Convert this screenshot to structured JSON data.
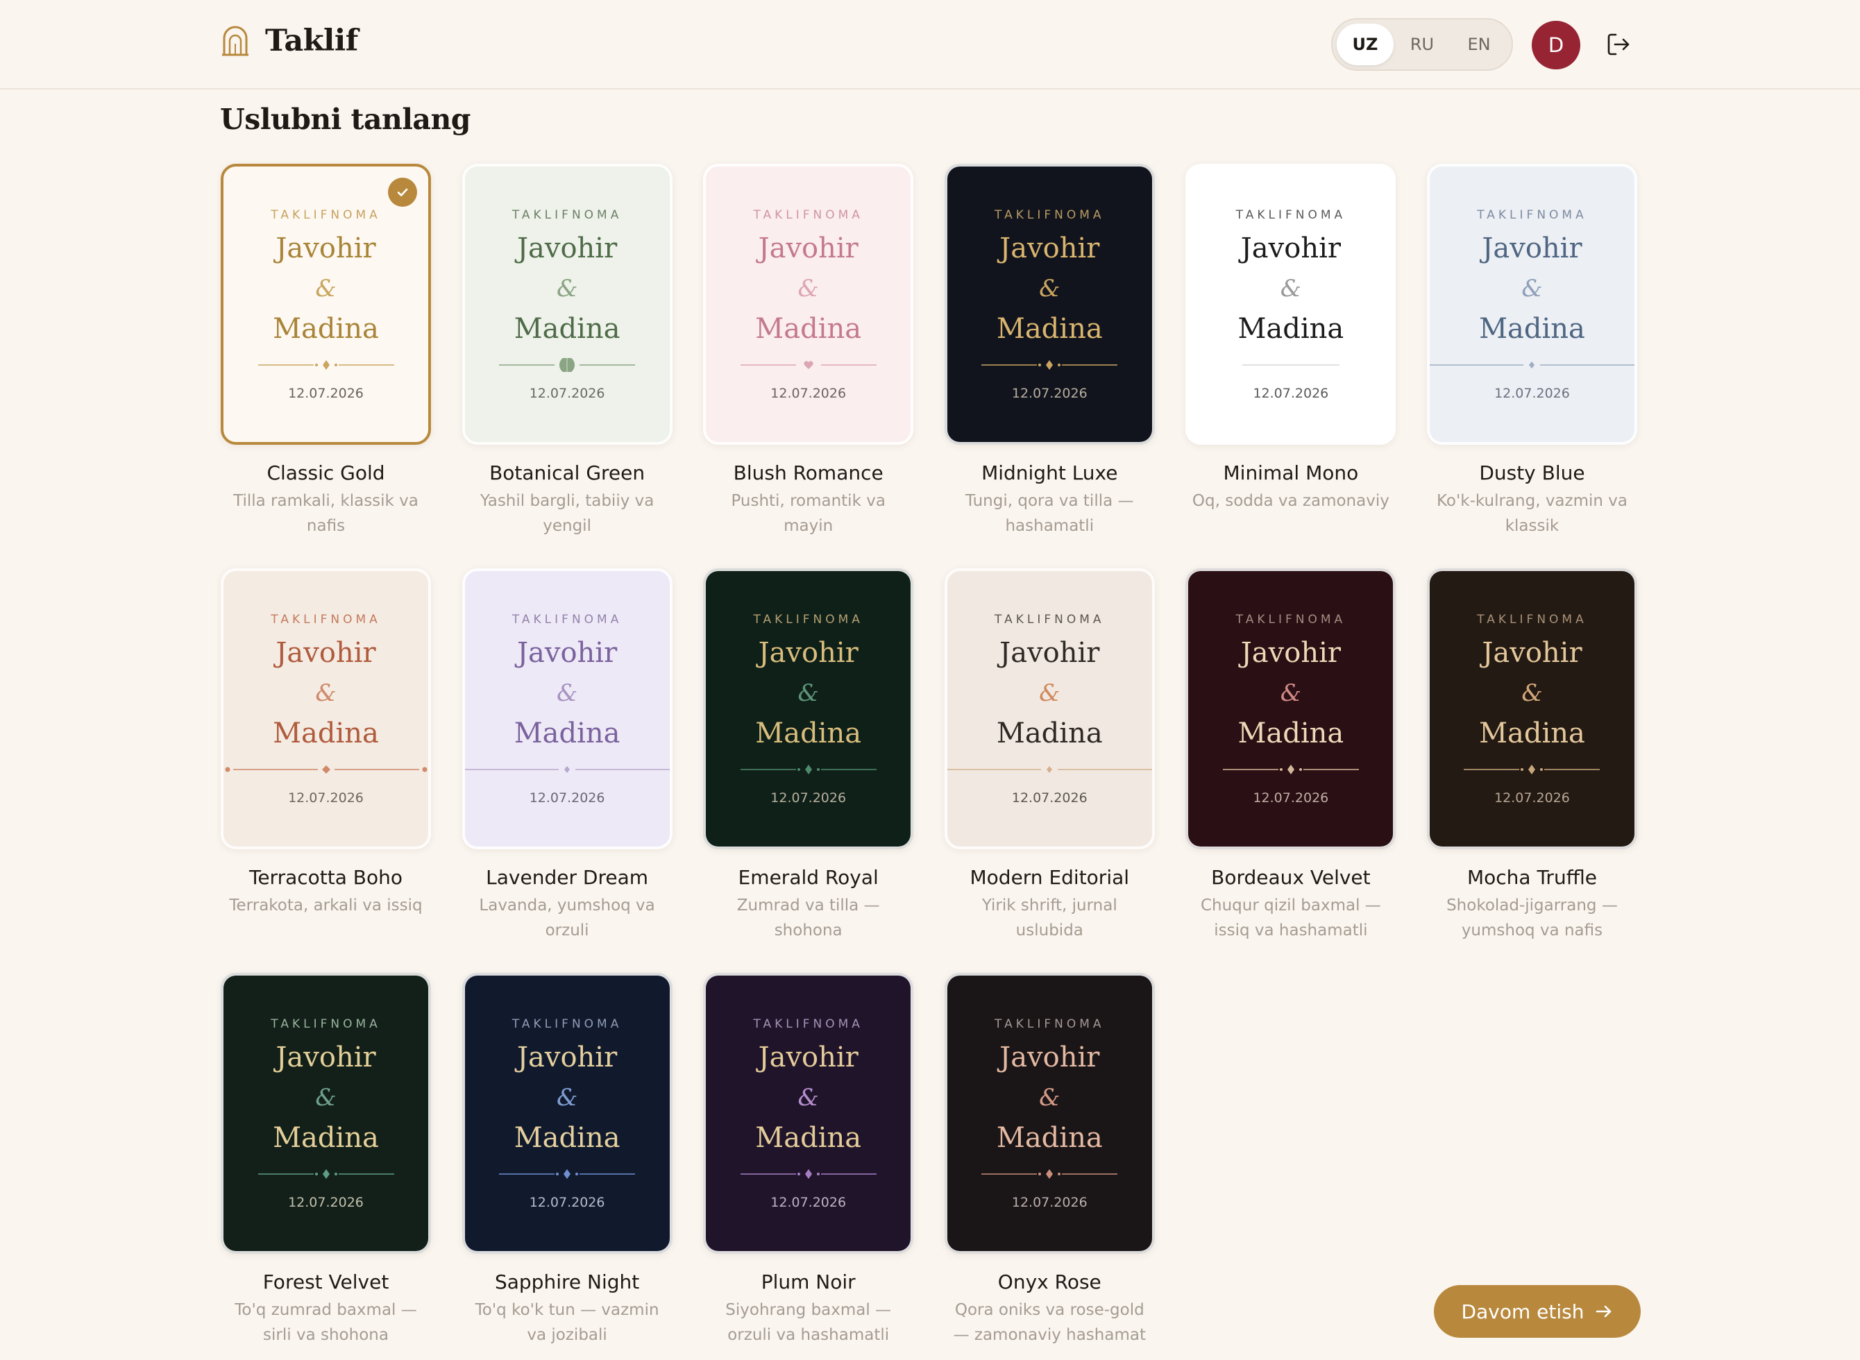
{
  "header": {
    "brand": "Taklif",
    "languages": [
      {
        "code": "UZ",
        "active": true
      },
      {
        "code": "RU",
        "active": false
      },
      {
        "code": "EN",
        "active": false
      }
    ],
    "avatar_initial": "D"
  },
  "main": {
    "title": "Uslubni tanlang",
    "continue_label": "Davom etish"
  },
  "preview": {
    "tag": "TAKLIFNOMA",
    "groom": "Javohir",
    "amp": "&",
    "bride": "Madina",
    "date": "12.07.2026"
  },
  "styles": [
    {
      "title": "Classic Gold",
      "desc": "Tilla ramkali, klassik va nafis",
      "selected": true,
      "colors": {
        "bg": "#fdf9f2",
        "name": "#a98438",
        "tag": "#c7a15e",
        "amp": "#c9a560",
        "line": "#c9a560",
        "date": "#6b6158"
      },
      "divider": "diamond"
    },
    {
      "title": "Botanical Green",
      "desc": "Yashil bargli, tabiiy va yengil",
      "selected": false,
      "colors": {
        "bg": "#eef2ea",
        "name": "#4f6b48",
        "tag": "#6d7f67",
        "amp": "#8aa583",
        "line": "#8aa583",
        "date": "#666b62"
      },
      "divider": "leaf"
    },
    {
      "title": "Blush Romance",
      "desc": "Pushti, romantik va mayin",
      "selected": false,
      "colors": {
        "bg": "#fbeeee",
        "name": "#c47a8c",
        "tag": "#cf95a2",
        "amp": "#dca6b2",
        "line": "#dca6b2",
        "date": "#6e6264"
      },
      "divider": "heart"
    },
    {
      "title": "Midnight Luxe",
      "desc": "Tungi, qora va tilla — hashamatli",
      "selected": false,
      "colors": {
        "bg": "#12141d",
        "name": "#d9b56e",
        "tag": "#b79b63",
        "amp": "#c9a560",
        "line": "#c9a560",
        "date": "#b7ae9f"
      },
      "divider": "diamond"
    },
    {
      "title": "Minimal Mono",
      "desc": "Oq, sodda va zamonaviy",
      "selected": false,
      "colors": {
        "bg": "#ffffff",
        "name": "#1c1c1c",
        "tag": "#5a5a5a",
        "amp": "#9a9a9a",
        "line": "#d7d7d7",
        "date": "#5a5a5a"
      },
      "divider": "line"
    },
    {
      "title": "Dusty Blue",
      "desc": "Ko'k-kulrang, vazmin va klassik",
      "selected": false,
      "colors": {
        "bg": "#eceff4",
        "name": "#4f6682",
        "tag": "#7d8ba0",
        "amp": "#8fa0b8",
        "line": "#9eadc2",
        "date": "#6a7080"
      },
      "divider": "wide-dot"
    },
    {
      "title": "Terracotta Boho",
      "desc": "Terrakota, arkali va issiq",
      "selected": false,
      "colors": {
        "bg": "#f4ebe2",
        "name": "#b05b3d",
        "tag": "#c47a5d",
        "amp": "#d08a6a",
        "line": "#d08a6a",
        "date": "#6f655c"
      },
      "divider": "wide-diamond"
    },
    {
      "title": "Lavender Dream",
      "desc": "Lavanda, yumshoq va orzuli",
      "selected": false,
      "colors": {
        "bg": "#eee9f6",
        "name": "#7a629e",
        "tag": "#9383ad",
        "amp": "#a794c2",
        "line": "#b7a8cf",
        "date": "#6b6676"
      },
      "divider": "wide-dot"
    },
    {
      "title": "Emerald Royal",
      "desc": "Zumrad va tilla — shohona",
      "selected": false,
      "colors": {
        "bg": "#0f2019",
        "name": "#d9bd7c",
        "tag": "#b5a072",
        "amp": "#5e9478",
        "line": "#4d8a6c",
        "date": "#b7b09e"
      },
      "divider": "diamond"
    },
    {
      "title": "Modern Editorial",
      "desc": "Yirik shrift, jurnal uslubida",
      "selected": false,
      "colors": {
        "bg": "#f1e9e1",
        "name": "#2e2925",
        "tag": "#5d5650",
        "amp": "#d08a5e",
        "line": "#d6b08e",
        "date": "#5d5650"
      },
      "divider": "wide-dot"
    },
    {
      "title": "Bordeaux Velvet",
      "desc": "Chuqur qizil baxmal — issiq va hashamatli",
      "selected": false,
      "colors": {
        "bg": "#2a0f14",
        "name": "#ecd9b8",
        "tag": "#a78c82",
        "amp": "#d08a86",
        "line": "#d3b89a",
        "date": "#c0aea4"
      },
      "divider": "diamond-rose"
    },
    {
      "title": "Mocha Truffle",
      "desc": "Shokolad-jigarrang — yumshoq va nafis",
      "selected": false,
      "colors": {
        "bg": "#241a14",
        "name": "#e4c89c",
        "tag": "#a89277",
        "amp": "#d4a77a",
        "line": "#c9a77c",
        "date": "#b7a794"
      },
      "divider": "diamond"
    },
    {
      "title": "Forest Velvet",
      "desc": "To'q zumrad baxmal — sirli va shohona",
      "selected": false,
      "colors": {
        "bg": "#122019",
        "name": "#e4cf99",
        "tag": "#9ab29f",
        "amp": "#6ea08a",
        "line": "#5f9d82",
        "date": "#c4c0ad"
      },
      "divider": "diamond-teal"
    },
    {
      "title": "Sapphire Night",
      "desc": "To'q ko'k tun — vazmin va jozibali",
      "selected": false,
      "colors": {
        "bg": "#111a2d",
        "name": "#e5d09e",
        "tag": "#8f9cb6",
        "amp": "#7f9dd2",
        "line": "#6f90d0",
        "date": "#b8bccb"
      },
      "divider": "diamond-blue"
    },
    {
      "title": "Plum Noir",
      "desc": "Siyohrang baxmal — orzuli va hashamatli",
      "selected": false,
      "colors": {
        "bg": "#20142a",
        "name": "#e4cc99",
        "tag": "#a693b7",
        "amp": "#b58dcc",
        "line": "#a67ec4",
        "date": "#bdb3c4"
      },
      "divider": "diamond-purple"
    },
    {
      "title": "Onyx Rose",
      "desc": "Qora oniks va rose-gold — zamonaviy hashamat",
      "selected": false,
      "colors": {
        "bg": "#1a1517",
        "name": "#e4b9a2",
        "tag": "#a59995",
        "amp": "#d49a86",
        "line": "#c98f7c",
        "date": "#bbb0ac"
      },
      "divider": "diamond-rose"
    }
  ]
}
